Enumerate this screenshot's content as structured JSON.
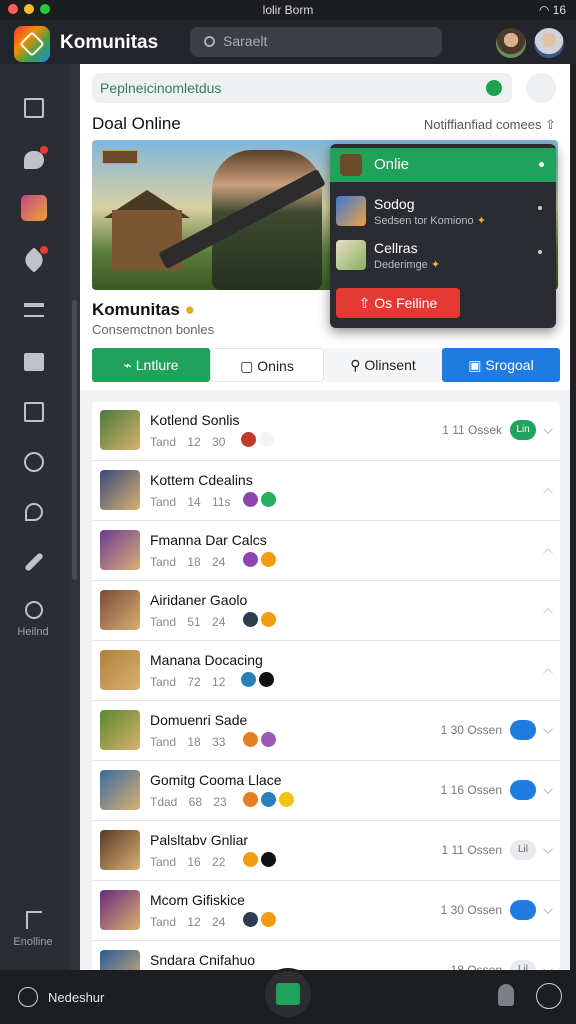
{
  "statusbar": {
    "center": "lolir Borm",
    "right": "16"
  },
  "app": {
    "title": "Komunitas"
  },
  "search": {
    "placeholder": "Saraelt"
  },
  "rail": {
    "bottom_label": "Heilnd",
    "settings_label": "Enolline"
  },
  "card": {
    "link": "Peplneicinomletdus",
    "section_title": "Doal Online",
    "notification_text": "Notiffianfiad comees",
    "name": "Komunitas",
    "subtitle": "Consemctnon bonles"
  },
  "popup": {
    "header": "Onlie",
    "items": [
      {
        "title": "Sodog",
        "subtitle": "Sedsen tor Komiono"
      },
      {
        "title": "Cellras",
        "subtitle": "Dederimge"
      }
    ],
    "button": "Os Feiline"
  },
  "tabs": [
    {
      "label": "Lntlure",
      "color": "#1fa25a"
    },
    {
      "label": "Onins"
    },
    {
      "label": "Olinsent"
    },
    {
      "label": "Srogoal",
      "color": "#1e7be0"
    }
  ],
  "rows": [
    {
      "name": "Kotlend Sonlis",
      "sub": "Tand 12 30",
      "time": "1 11 Ossek",
      "pill": "Lin",
      "pill_color": "#1fa25a",
      "chevron": "down",
      "thumb": "#4a7a3a"
    },
    {
      "name": "Kottem Cdealins",
      "sub": "Tand 14 11s",
      "time": "",
      "pill": "",
      "pill_color": "",
      "chevron": "up",
      "thumb": "#3b4a7a"
    },
    {
      "name": "Fmanna Dar Calcs",
      "sub": "Tand 18 24",
      "time": "",
      "pill": "",
      "pill_color": "",
      "chevron": "up",
      "thumb": "#6a3a9a"
    },
    {
      "name": "Airidaner Gaolo",
      "sub": "Tand 51 24",
      "time": "",
      "pill": "",
      "pill_color": "",
      "chevron": "up",
      "thumb": "#7a4a3a"
    },
    {
      "name": "Manana Docacing",
      "sub": "Tand 72 12",
      "time": "",
      "pill": "",
      "pill_color": "",
      "chevron": "up",
      "thumb": "#b0823a"
    },
    {
      "name": "Domuenri Sade",
      "sub": "Tand 18 33",
      "time": "1 30 Ossen",
      "pill": "",
      "pill_color": "#1e7be0",
      "chevron": "down",
      "thumb": "#5a8a2a"
    },
    {
      "name": "Gomitg Cooma Llace",
      "sub": "Tdad 68 23",
      "time": "1 16 Ossen",
      "pill": "",
      "pill_color": "#1e7be0",
      "chevron": "down",
      "thumb": "#3a6aa0"
    },
    {
      "name": "Palsltabv Gnliar",
      "sub": "Tand 16 22",
      "time": "1 11 Ossen",
      "pill": "Lil",
      "pill_color": "#e8eaee",
      "chevron": "down",
      "thumb": "#5a3a2a"
    },
    {
      "name": "Mcom Gifiskice",
      "sub": "Tand 12 24",
      "time": "1 30 Ossen",
      "pill": "",
      "pill_color": "#1e7be0",
      "chevron": "down",
      "thumb": "#6a2a7a"
    },
    {
      "name": "Sndara Cnifahuo",
      "sub": "",
      "time": "18 Ossen",
      "pill": "Lil",
      "pill_color": "#e8eaee",
      "chevron": "down",
      "thumb": "#2a5a9a"
    }
  ],
  "bottom": {
    "status_label": "Nedeshur"
  },
  "colors": {
    "accent_green": "#1fa25a",
    "accent_blue": "#1e7be0",
    "danger_red": "#e53935",
    "dark_bg": "#1e2024"
  }
}
